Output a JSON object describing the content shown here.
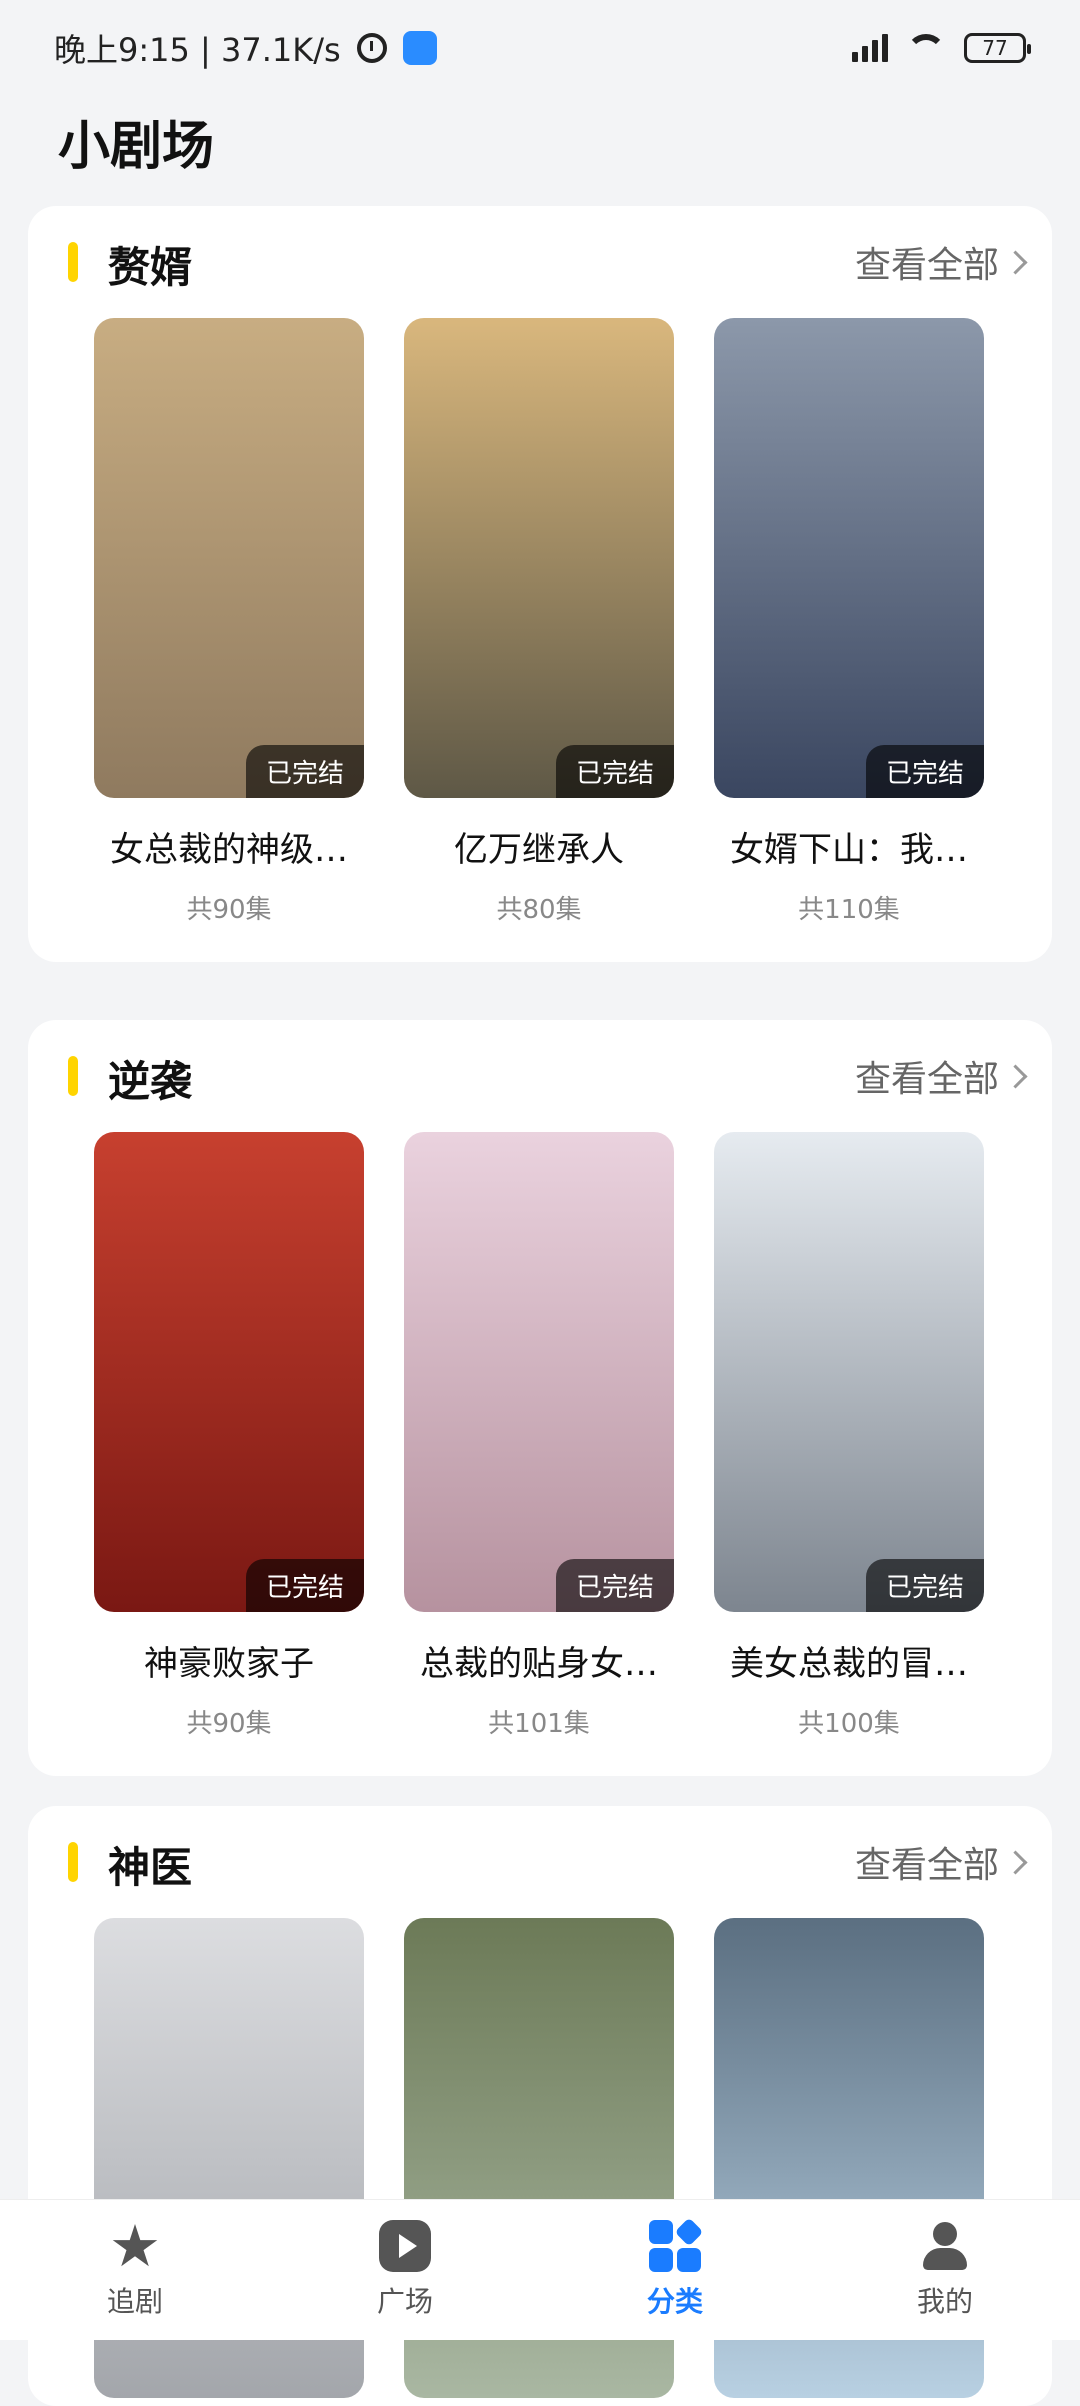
{
  "status_bar": {
    "time_speed": "晚上9:15 | 37.1K/s",
    "battery": "77"
  },
  "page": {
    "title": "小剧场"
  },
  "sections": [
    {
      "title": "赘婿",
      "view_all": "查看全部",
      "items": [
        {
          "title": "女总裁的神级…",
          "episodes": "共90集",
          "badge": "已完结",
          "color": "#a58b66"
        },
        {
          "title": "亿万继承人",
          "episodes": "共80集",
          "badge": "已完结",
          "color": "#c2a562"
        },
        {
          "title": "女婿下山：我…",
          "episodes": "共110集",
          "badge": "已完结",
          "color": "#6d7a94"
        }
      ]
    },
    {
      "title": "逆袭",
      "view_all": "查看全部",
      "items": [
        {
          "title": "神豪败家子",
          "episodes": "共90集",
          "badge": "已完结",
          "color": "#b0302a"
        },
        {
          "title": "总裁的贴身女…",
          "episodes": "共101集",
          "badge": "已完结",
          "color": "#d8b6c6"
        },
        {
          "title": "美女总裁的冒…",
          "episodes": "共100集",
          "badge": "已完结",
          "color": "#cbd3db"
        }
      ]
    },
    {
      "title": "神医",
      "view_all": "查看全部",
      "items": [
        {
          "title": "",
          "episodes": "",
          "badge": "",
          "color": "#c9cbcf"
        },
        {
          "title": "",
          "episodes": "",
          "badge": "",
          "color": "#7e8e6a"
        },
        {
          "title": "",
          "episodes": "",
          "badge": "",
          "color": "#7391a7"
        }
      ]
    }
  ],
  "tabs": [
    {
      "label": "追剧",
      "icon": "star-icon"
    },
    {
      "label": "广场",
      "icon": "play-icon"
    },
    {
      "label": "分类",
      "icon": "grid-icon",
      "active": true
    },
    {
      "label": "我的",
      "icon": "user-icon"
    }
  ]
}
